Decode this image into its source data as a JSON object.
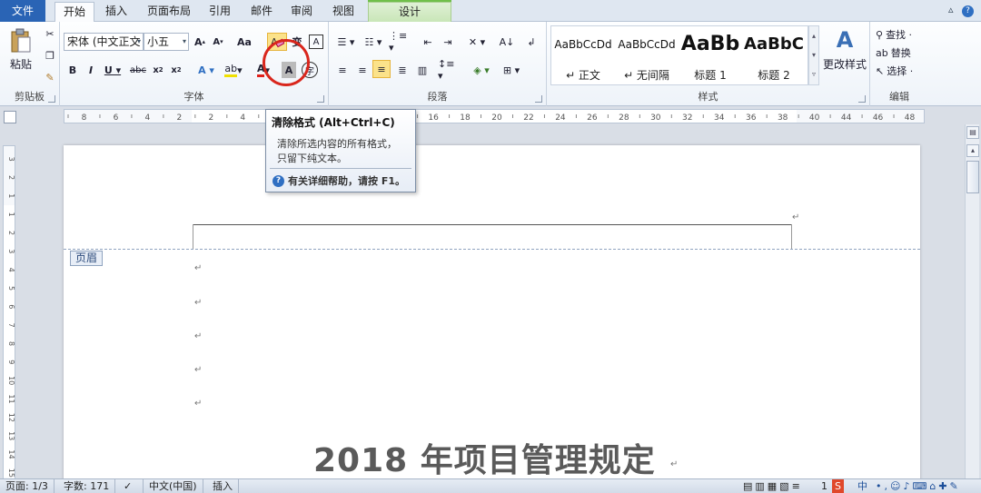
{
  "tabs": {
    "file": "文件",
    "home": "开始",
    "insert": "插入",
    "layout": "页面布局",
    "references": "引用",
    "mailings": "邮件",
    "review": "审阅",
    "view": "视图",
    "design": "设计"
  },
  "clipboard": {
    "paste": "粘贴",
    "group": "剪贴板"
  },
  "font": {
    "name": "宋体 (中文正文",
    "size": "小五",
    "group": "字体",
    "grow_icon": "grow-font-icon",
    "shrink_icon": "shrink-font-icon"
  },
  "paragraph": {
    "group": "段落"
  },
  "styles": {
    "group": "样式",
    "items": [
      {
        "sample": "AaBbCcDd",
        "name": "↵ 正文"
      },
      {
        "sample": "AaBbCcDd",
        "name": "↵ 无间隔"
      },
      {
        "sample": "AaBb",
        "name": "标题 1"
      },
      {
        "sample": "AaBbC",
        "name": "标题 2"
      }
    ],
    "change": "更改样式"
  },
  "editing": {
    "group": "编辑",
    "find": "查找 ·",
    "replace": "替换",
    "select": "选择 ·"
  },
  "ruler": {
    "ticks": [
      "8",
      "6",
      "4",
      "2",
      "2",
      "4",
      "6",
      "8",
      "10",
      "12",
      "14",
      "16",
      "18",
      "20",
      "22",
      "24",
      "26",
      "28",
      "30",
      "32",
      "34",
      "36",
      "38",
      "40",
      "44",
      "46",
      "48"
    ],
    "vticks": [
      "3",
      "2",
      "1",
      "1",
      "2",
      "3",
      "4",
      "5",
      "6",
      "7",
      "8",
      "9",
      "10",
      "11",
      "12",
      "13",
      "14",
      "15"
    ]
  },
  "tooltip": {
    "title": "清除格式 (Alt+Ctrl+C)",
    "desc_line1": "清除所选内容的所有格式，",
    "desc_line2": "只留下纯文本。",
    "help": "有关详细帮助，请按 F1。"
  },
  "document": {
    "header_tag": "页眉",
    "para_mark": "↵",
    "title": "2018 年项目管理规定"
  },
  "status": {
    "page": "页面: 1/3",
    "words": "字数: 171",
    "language": "中文(中国)",
    "mode": "插入",
    "zoom_fragment": "1",
    "ime": "中"
  },
  "colors": {
    "file_tab": "#2a64b5",
    "highlight": "#fbe28a",
    "circle": "#d9261c",
    "font_color": "#e0201a"
  }
}
